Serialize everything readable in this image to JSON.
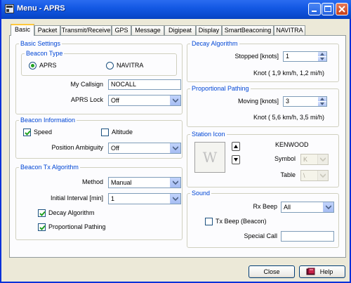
{
  "window": {
    "title": "Menu - APRS"
  },
  "tabs": [
    {
      "label": "Basic",
      "active": true
    },
    {
      "label": "Packet"
    },
    {
      "label": "Transmit/Receive"
    },
    {
      "label": "GPS"
    },
    {
      "label": "Message"
    },
    {
      "label": "Digipeat"
    },
    {
      "label": "Display"
    },
    {
      "label": "SmartBeaconing"
    },
    {
      "label": "NAVITRA"
    }
  ],
  "basic_settings": {
    "title": "Basic Settings",
    "beacon_type": {
      "title": "Beacon Type",
      "aprs": "APRS",
      "navitra": "NAVITRA",
      "selected": "APRS"
    },
    "callsign_label": "My Callsign",
    "callsign_value": "NOCALL",
    "aprs_lock_label": "APRS Lock",
    "aprs_lock_value": "Off"
  },
  "beacon_information": {
    "title": "Beacon Information",
    "speed_label": "Speed",
    "speed_checked": true,
    "altitude_label": "Altitude",
    "altitude_checked": false,
    "ambiguity_label": "Position Ambiguity",
    "ambiguity_value": "Off"
  },
  "beacon_tx": {
    "title": "Beacon Tx Algorithm",
    "method_label": "Method",
    "method_value": "Manual",
    "interval_label": "Initial Interval [min]",
    "interval_value": "1",
    "decay_label": "Decay Algorithm",
    "decay_checked": true,
    "pathing_label": "Proportional Pathing",
    "pathing_checked": true
  },
  "decay_algorithm": {
    "title": "Decay Algorithm",
    "stopped_label": "Stopped [knots]",
    "stopped_value": "1",
    "stopped_note": "Knot ( 1,9 km/h, 1,2 mi/h)"
  },
  "proportional_pathing": {
    "title": "Proportional Pathing",
    "moving_label": "Moving [knots]",
    "moving_value": "3",
    "moving_note": "Knot ( 5,6 km/h, 3,5 mi/h)"
  },
  "station_icon": {
    "title": "Station Icon",
    "brand": "KENWOOD",
    "symbol_label": "Symbol",
    "symbol_value": "K",
    "table_label": "Table",
    "table_value": "\\",
    "preview_glyph": "W"
  },
  "sound": {
    "title": "Sound",
    "rx_beep_label": "Rx Beep",
    "rx_beep_value": "All",
    "tx_beep_label": "Tx Beep (Beacon)",
    "tx_beep_checked": false,
    "special_call_label": "Special Call",
    "special_call_value": ""
  },
  "footer": {
    "close_label": "Close",
    "help_label": "Help"
  },
  "icons": [
    "app-menu-icon",
    "minimize-icon",
    "maximize-icon",
    "close-icon",
    "help-book-icon",
    "arrow-up-icon",
    "arrow-down-icon",
    "chevron-down-icon",
    "checkmark-icon"
  ],
  "colors": {
    "title_bar": "#0a4bd0",
    "group_title": "#0046d5",
    "check": "#21a121",
    "active_tab_accent": "#ffc83c"
  }
}
